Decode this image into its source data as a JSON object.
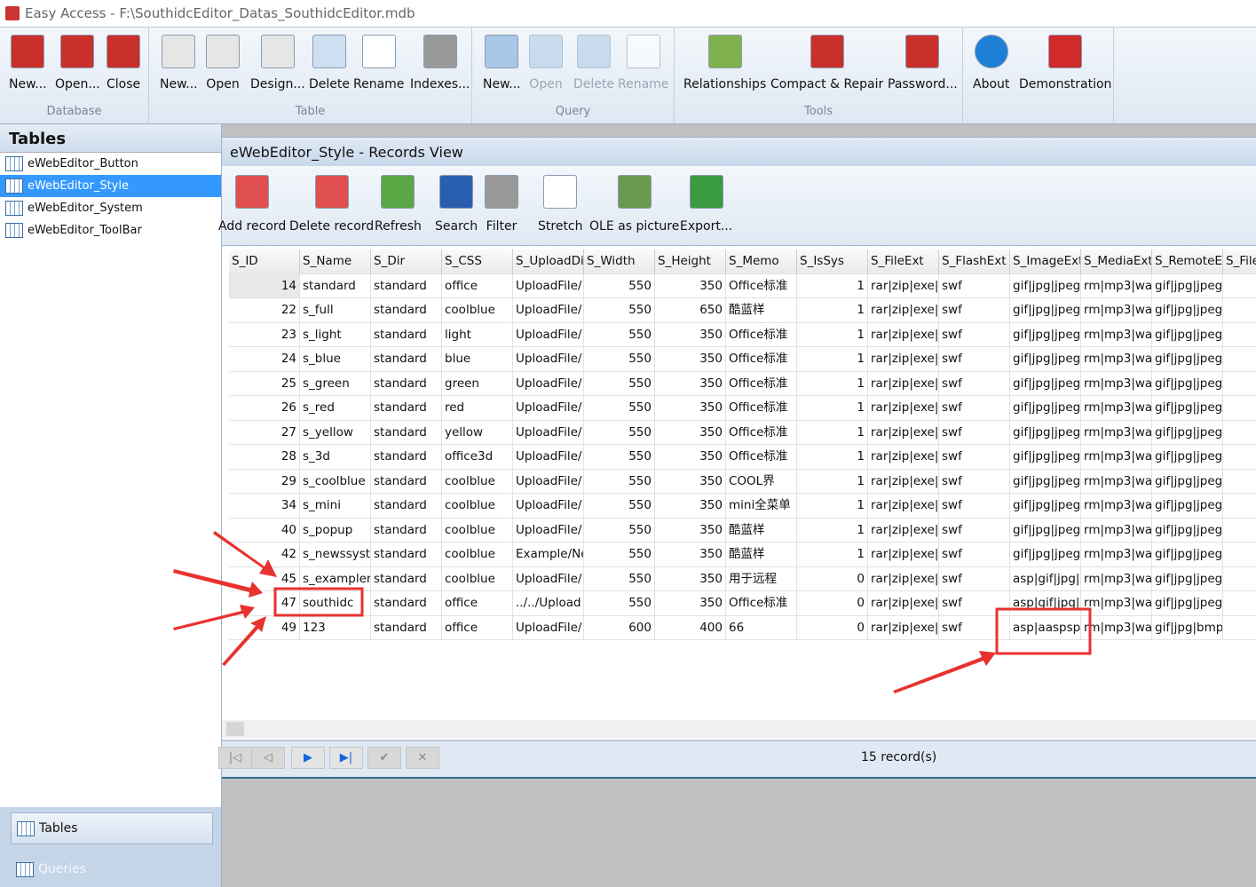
{
  "window": {
    "title": "Easy Access - F:\\SouthidcEditor_Datas_SouthidcEditor.mdb"
  },
  "ribbon": {
    "groups": [
      {
        "label": "Database",
        "buttons": [
          {
            "label": "New...",
            "icon": "new-database-icon",
            "enabled": true
          },
          {
            "label": "Open...",
            "icon": "open-database-icon",
            "enabled": true
          },
          {
            "label": "Close",
            "icon": "close-database-icon",
            "enabled": true
          }
        ]
      },
      {
        "label": "Table",
        "buttons": [
          {
            "label": "New...",
            "icon": "new-table-icon",
            "enabled": true
          },
          {
            "label": "Open",
            "icon": "open-table-icon",
            "enabled": true
          },
          {
            "label": "Design...",
            "icon": "design-table-icon",
            "enabled": true
          },
          {
            "label": "Delete",
            "icon": "delete-table-icon",
            "enabled": true
          },
          {
            "label": "Rename",
            "icon": "rename-icon",
            "enabled": true
          },
          {
            "label": "Indexes...",
            "icon": "indexes-icon",
            "enabled": true
          }
        ]
      },
      {
        "label": "Query",
        "buttons": [
          {
            "label": "New...",
            "icon": "new-query-icon",
            "enabled": true
          },
          {
            "label": "Open",
            "icon": "open-query-icon",
            "enabled": false
          },
          {
            "label": "Delete",
            "icon": "delete-query-icon",
            "enabled": false
          },
          {
            "label": "Rename",
            "icon": "rename-query-icon",
            "enabled": false
          }
        ]
      },
      {
        "label": "Tools",
        "buttons": [
          {
            "label": "Relationships",
            "icon": "relationships-icon",
            "enabled": true
          },
          {
            "label": "Compact & Repair",
            "icon": "compact-repair-icon",
            "enabled": true
          },
          {
            "label": "Password...",
            "icon": "password-icon",
            "enabled": true
          }
        ]
      },
      {
        "label": "",
        "buttons": [
          {
            "label": "About",
            "icon": "info-icon",
            "enabled": true
          },
          {
            "label": "Demonstration",
            "icon": "youtube-icon",
            "enabled": true
          }
        ]
      }
    ]
  },
  "sidebar": {
    "header": "Tables",
    "tables": [
      {
        "label": "eWebEditor_Button",
        "selected": false
      },
      {
        "label": "eWebEditor_Style",
        "selected": true
      },
      {
        "label": "eWebEditor_System",
        "selected": false
      },
      {
        "label": "eWebEditor_ToolBar",
        "selected": false
      }
    ],
    "nav": [
      {
        "label": "Tables",
        "active": true
      },
      {
        "label": "Queries",
        "active": false
      }
    ]
  },
  "records_view": {
    "title": "eWebEditor_Style - Records View",
    "toolbar": [
      {
        "label": "Add record",
        "icon": "add-record-icon"
      },
      {
        "label": "Delete record",
        "icon": "delete-record-icon"
      },
      {
        "label": "Refresh",
        "icon": "refresh-icon"
      },
      {
        "label": "Search",
        "icon": "search-icon"
      },
      {
        "label": "Filter",
        "icon": "filter-icon"
      },
      {
        "label": "Stretch",
        "icon": "stretch-icon"
      },
      {
        "label": "OLE as picture",
        "icon": "picture-icon"
      },
      {
        "label": "Export...",
        "icon": "export-icon"
      }
    ],
    "columns": [
      "S_ID",
      "S_Name",
      "S_Dir",
      "S_CSS",
      "S_UploadDir",
      "S_Width",
      "S_Height",
      "S_Memo",
      "S_IsSys",
      "S_FileExt",
      "S_FlashExt",
      "S_ImageExt",
      "S_MediaExt",
      "S_RemoteE",
      "S_File"
    ],
    "rows": [
      [
        "14",
        "standard",
        "standard",
        "office",
        "UploadFile/",
        "550",
        "350",
        "Office标准",
        "1",
        "rar|zip|exe|",
        "swf",
        "gif|jpg|jpeg",
        "rm|mp3|wa",
        "gif|jpg|jpeg",
        ""
      ],
      [
        "22",
        "s_full",
        "standard",
        "coolblue",
        "UploadFile/",
        "550",
        "650",
        "酷蓝样",
        "1",
        "rar|zip|exe|",
        "swf",
        "gif|jpg|jpeg",
        "rm|mp3|wa",
        "gif|jpg|jpeg",
        ""
      ],
      [
        "23",
        "s_light",
        "standard",
        "light",
        "UploadFile/",
        "550",
        "350",
        "Office标准",
        "1",
        "rar|zip|exe|",
        "swf",
        "gif|jpg|jpeg",
        "rm|mp3|wa",
        "gif|jpg|jpeg",
        ""
      ],
      [
        "24",
        "s_blue",
        "standard",
        "blue",
        "UploadFile/",
        "550",
        "350",
        "Office标准",
        "1",
        "rar|zip|exe|",
        "swf",
        "gif|jpg|jpeg",
        "rm|mp3|wa",
        "gif|jpg|jpeg",
        ""
      ],
      [
        "25",
        "s_green",
        "standard",
        "green",
        "UploadFile/",
        "550",
        "350",
        "Office标准",
        "1",
        "rar|zip|exe|",
        "swf",
        "gif|jpg|jpeg",
        "rm|mp3|wa",
        "gif|jpg|jpeg",
        ""
      ],
      [
        "26",
        "s_red",
        "standard",
        "red",
        "UploadFile/",
        "550",
        "350",
        "Office标准",
        "1",
        "rar|zip|exe|",
        "swf",
        "gif|jpg|jpeg",
        "rm|mp3|wa",
        "gif|jpg|jpeg",
        ""
      ],
      [
        "27",
        "s_yellow",
        "standard",
        "yellow",
        "UploadFile/",
        "550",
        "350",
        "Office标准",
        "1",
        "rar|zip|exe|",
        "swf",
        "gif|jpg|jpeg",
        "rm|mp3|wa",
        "gif|jpg|jpeg",
        ""
      ],
      [
        "28",
        "s_3d",
        "standard",
        "office3d",
        "UploadFile/",
        "550",
        "350",
        "Office标准",
        "1",
        "rar|zip|exe|",
        "swf",
        "gif|jpg|jpeg",
        "rm|mp3|wa",
        "gif|jpg|jpeg",
        ""
      ],
      [
        "29",
        "s_coolblue",
        "standard",
        "coolblue",
        "UploadFile/",
        "550",
        "350",
        "COOL界",
        "1",
        "rar|zip|exe|",
        "swf",
        "gif|jpg|jpeg",
        "rm|mp3|wa",
        "gif|jpg|jpeg",
        ""
      ],
      [
        "34",
        "s_mini",
        "standard",
        "coolblue",
        "UploadFile/",
        "550",
        "350",
        "mini全菜单",
        "1",
        "rar|zip|exe|",
        "swf",
        "gif|jpg|jpeg",
        "rm|mp3|wa",
        "gif|jpg|jpeg",
        ""
      ],
      [
        "40",
        "s_popup",
        "standard",
        "coolblue",
        "UploadFile/",
        "550",
        "350",
        "酷蓝样",
        "1",
        "rar|zip|exe|",
        "swf",
        "gif|jpg|jpeg",
        "rm|mp3|wa",
        "gif|jpg|jpeg",
        ""
      ],
      [
        "42",
        "s_newssyst",
        "standard",
        "coolblue",
        "Example/Ne",
        "550",
        "350",
        "酷蓝样",
        "1",
        "rar|zip|exe|",
        "swf",
        "gif|jpg|jpeg",
        "rm|mp3|wa",
        "gif|jpg|jpeg",
        ""
      ],
      [
        "45",
        "s_exampler",
        "standard",
        "coolblue",
        "UploadFile/",
        "550",
        "350",
        "用于远程",
        "0",
        "rar|zip|exe|",
        "swf",
        "asp|gif|jpg|",
        "rm|mp3|wa",
        "gif|jpg|jpeg",
        ""
      ],
      [
        "47",
        "southidc",
        "standard",
        "office",
        "../../Upload",
        "550",
        "350",
        "Office标准",
        "0",
        "rar|zip|exe|",
        "swf",
        "asp|gif|jpg|",
        "rm|mp3|wa",
        "gif|jpg|jpeg",
        ""
      ],
      [
        "49",
        "123",
        "standard",
        "office",
        "UploadFile/",
        "600",
        "400",
        "66",
        "0",
        "rar|zip|exe|",
        "swf",
        "asp|aaspsp",
        "rm|mp3|wa",
        "gif|jpg|bmp",
        ""
      ]
    ],
    "record_count": "15 record(s)",
    "nav_buttons": [
      {
        "label": "|◁",
        "name": "first-record-button"
      },
      {
        "label": "◁",
        "name": "prev-record-button"
      },
      {
        "label": "▶",
        "name": "next-record-button"
      },
      {
        "label": "▶|",
        "name": "last-record-button"
      },
      {
        "label": "✔",
        "name": "post-button"
      },
      {
        "label": "✕",
        "name": "cancel-button"
      }
    ]
  },
  "colors": {
    "selection": "#3399ff",
    "annotation": "#e8322f",
    "ribbon_bg": "#dfe8f3"
  }
}
